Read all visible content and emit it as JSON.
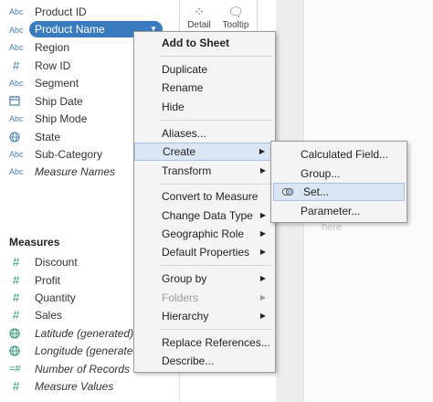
{
  "dimensions": {
    "fields": [
      {
        "icon": "Abc",
        "label": "Product ID",
        "italic": false
      },
      {
        "icon": "Abc",
        "label": "Product Name",
        "italic": false,
        "selected": true
      },
      {
        "icon": "Abc",
        "label": "Region",
        "italic": false
      },
      {
        "icon": "#",
        "label": "Row ID",
        "italic": false
      },
      {
        "icon": "Abc",
        "label": "Segment",
        "italic": false
      },
      {
        "icon": "calendar",
        "label": "Ship Date",
        "italic": false
      },
      {
        "icon": "Abc",
        "label": "Ship Mode",
        "italic": false
      },
      {
        "icon": "globe",
        "label": "State",
        "italic": false
      },
      {
        "icon": "Abc",
        "label": "Sub-Category",
        "italic": false
      },
      {
        "icon": "Abc",
        "label": "Measure Names",
        "italic": true
      }
    ]
  },
  "measures": {
    "header": "Measures",
    "fields": [
      {
        "icon": "#",
        "label": "Discount",
        "italic": false
      },
      {
        "icon": "#",
        "label": "Profit",
        "italic": false
      },
      {
        "icon": "#",
        "label": "Quantity",
        "italic": false
      },
      {
        "icon": "#",
        "label": "Sales",
        "italic": false
      },
      {
        "icon": "globe",
        "label": "Latitude (generated)",
        "italic": true
      },
      {
        "icon": "globe",
        "label": "Longitude (generated)",
        "italic": true
      },
      {
        "icon": "=#",
        "label": "Number of Records",
        "italic": true
      },
      {
        "icon": "#",
        "label": "Measure Values",
        "italic": true
      }
    ]
  },
  "marks": {
    "detail_label": "Detail",
    "tooltip_label": "Tooltip"
  },
  "canvas": {
    "drop_hint": "here"
  },
  "context_menu": {
    "items": [
      {
        "label": "Add to Sheet",
        "bold": true
      },
      {
        "label": "Duplicate"
      },
      {
        "label": "Rename"
      },
      {
        "label": "Hide"
      },
      {
        "label": "Aliases..."
      },
      {
        "label": "Create",
        "submenu": true,
        "highlighted": true
      },
      {
        "label": "Transform",
        "submenu": true
      },
      {
        "label": "Convert to Measure"
      },
      {
        "label": "Change Data Type",
        "submenu": true
      },
      {
        "label": "Geographic Role",
        "submenu": true
      },
      {
        "label": "Default Properties",
        "submenu": true
      },
      {
        "label": "Group by",
        "submenu": true
      },
      {
        "label": "Folders",
        "submenu": true,
        "disabled": true
      },
      {
        "label": "Hierarchy",
        "submenu": true
      },
      {
        "label": "Replace References..."
      },
      {
        "label": "Describe..."
      }
    ]
  },
  "create_submenu": {
    "items": [
      {
        "label": "Calculated Field..."
      },
      {
        "label": "Group..."
      },
      {
        "label": "Set...",
        "highlighted": true,
        "icon": "set-icon"
      },
      {
        "label": "Parameter..."
      }
    ]
  },
  "colors": {
    "pill": "#3a7bbf",
    "dimension_icon": "#4a7fb0",
    "measure_icon": "#2a9a6a",
    "highlight_bg": "#dbe6f4"
  }
}
